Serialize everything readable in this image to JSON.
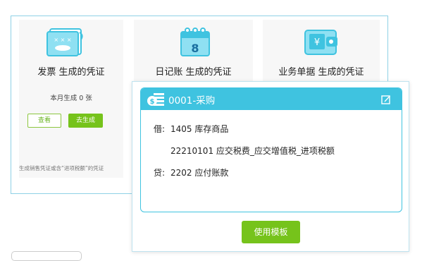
{
  "cards": [
    {
      "title": "发票 生成的凭证",
      "icon": "invoice-icon",
      "stat": "本月生成 0 张",
      "view_label": "查看",
      "generate_label": "去生成",
      "note": "生成销售凭证或含“进项税额”的凭证"
    },
    {
      "title": "日记账 生成的凭证",
      "icon": "journal-calendar-icon"
    },
    {
      "title": "业务单据 生成的凭证",
      "icon": "wallet-yen-icon"
    }
  ],
  "template": {
    "title": "0001-采购",
    "entries": [
      {
        "side": "借:",
        "text": "1405 库存商品"
      },
      {
        "side": "",
        "text": "22210101 应交税费_应交增值税_进项税额"
      },
      {
        "side": "贷:",
        "text": "2202 应付账款"
      }
    ],
    "use_label": "使用模板"
  },
  "colors": {
    "accent": "#3fc3e0",
    "green": "#76c31b"
  }
}
